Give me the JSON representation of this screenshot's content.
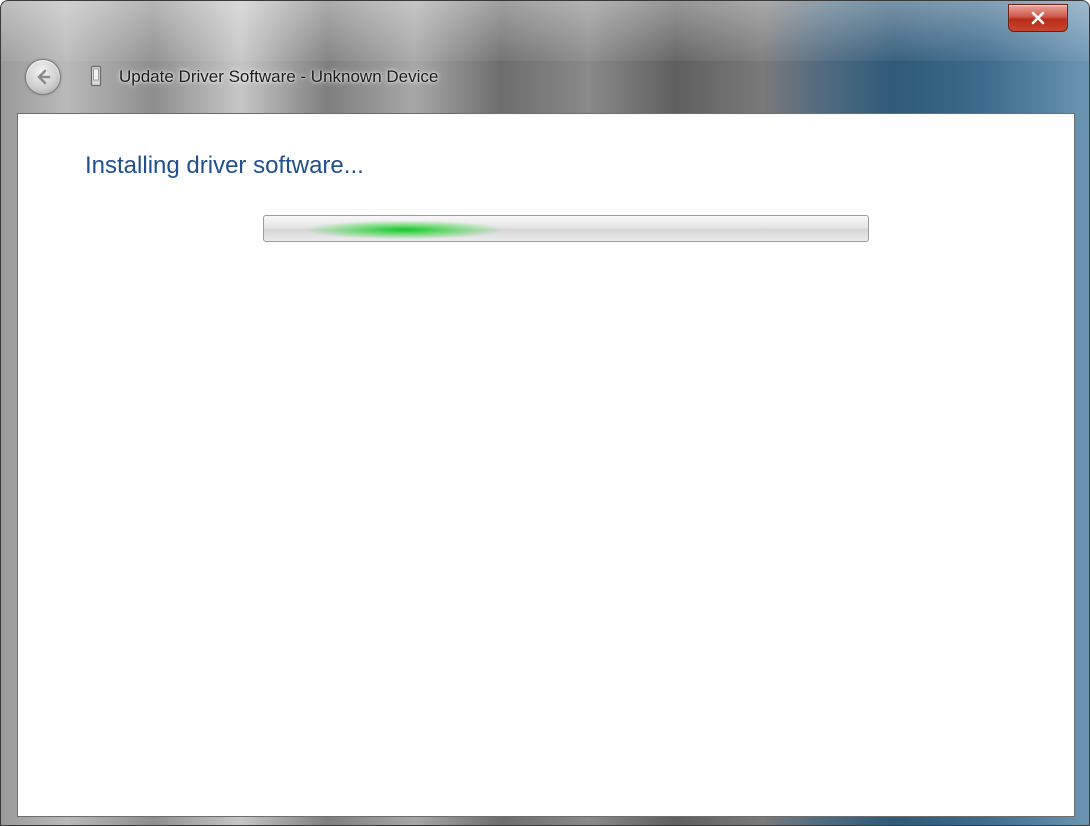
{
  "window": {
    "title": "Update Driver Software - Unknown Device",
    "icons": {
      "back": "back-arrow-icon",
      "device": "device-icon",
      "close": "close-icon"
    },
    "colors": {
      "heading": "#1f4f8f",
      "close_button": "#c9452f",
      "progress_glow": "#14c828"
    }
  },
  "content": {
    "heading": "Installing driver software...",
    "progress": {
      "mode": "indeterminate"
    }
  }
}
